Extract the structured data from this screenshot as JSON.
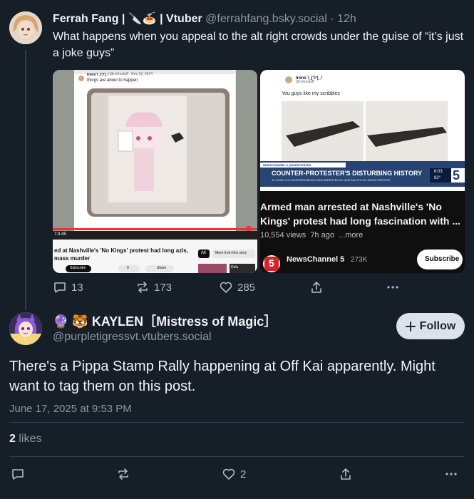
{
  "parent_post": {
    "author_name": "Ferrah Fang | 🔪🍝 | Vtuber",
    "author_handle": "@ferrahfang.bsky.social",
    "time_sep": " · ",
    "time": "12h",
    "text": "What happens when you appeal to the alt right crowds under the guise of “it’s just a joke guys”",
    "embed_left": {
      "tweet_user": "lrons`\\_(ツ)_/",
      "tweet_meta": "@rohmstuff · Dec 16, 2024",
      "tweet_text": "things are about to happen",
      "video_time": "7:3:45",
      "yt_title": "ed at Nashville's 'No Kings' protest had long azis, mass murder",
      "chip_all": "All",
      "chip_more": "More from this story",
      "subscribe": "Subscribe",
      "likes": "9",
      "share": "Share",
      "side_label": "Delu"
    },
    "embed_right": {
      "tweet_user": "lrons`\\_(ツ)_/",
      "tweet_meta": "@rohmstuff",
      "tweet_text": "You guys like my scribbles",
      "chyron_tag": "NEWSCHANNEL 5 | INVESTIGATES",
      "chyron_main": "COUNTER-PROTESTER'S DISTURBING HISTORY",
      "chyron_sub": "19-YEAR-OLD MURFREESBORO MAN ARRESTED AT NASHVILLE'S NO KINGS PROTEST",
      "chyron_time": "6:03",
      "chyron_temp": "82°",
      "channel_num": "5",
      "title": "Armed man arrested at Nashville's 'No Kings' protest had long fascination with ...",
      "meta": "10,554 views  7h ago  ...more",
      "channel": "NewsChannel 5",
      "subs": "273K",
      "subscribe": "Subscribe"
    },
    "actions": {
      "replies": "13",
      "reposts": "173",
      "likes": "285"
    }
  },
  "reply_post": {
    "author_name": "🔮 🐯 KAYLEN［Mistress of Magic］",
    "author_handle": "@purpletigressvt.vtubers.social",
    "follow_label": "Follow",
    "text": "There's a Pippa Stamp Rally happening at Off Kai apparently. Might want to tag them on this post.",
    "timestamp": "June 17, 2025 at 9:53 PM",
    "likes_count": "2",
    "likes_label": " likes",
    "actions": {
      "likes": "2"
    }
  },
  "colors": {
    "background": "#161e27",
    "muted": "#8b98a5",
    "divider": "#2e4052",
    "follow_bg": "#dce2ea"
  }
}
